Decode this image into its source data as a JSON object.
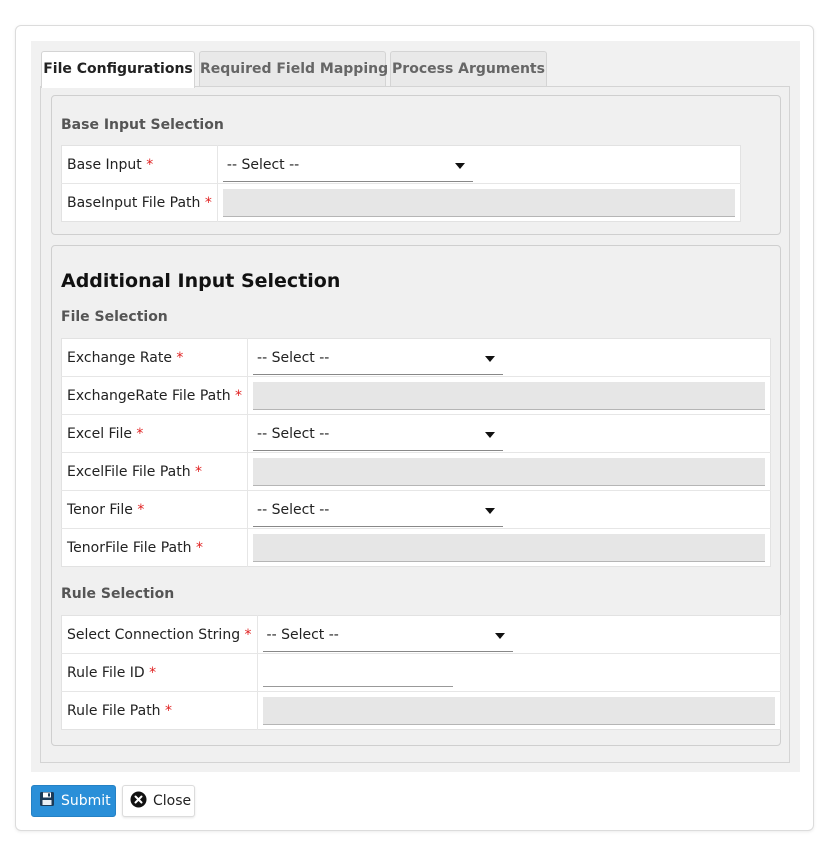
{
  "tabs": [
    "File Configurations",
    "Required Field Mapping",
    "Process Arguments"
  ],
  "required_marker": "*",
  "select_placeholder": "-- Select --",
  "base_section": {
    "legend": "Base Input Selection",
    "rows": [
      {
        "label": "Base Input",
        "type": "select",
        "value": "-- Select --"
      },
      {
        "label": "BaseInput File Path",
        "type": "path",
        "value": ""
      }
    ]
  },
  "additional_section": {
    "title": "Additional Input Selection",
    "file_selection": {
      "legend": "File Selection",
      "rows": [
        {
          "label": "Exchange Rate",
          "type": "select",
          "value": "-- Select --"
        },
        {
          "label": "ExchangeRate File Path",
          "type": "path",
          "value": ""
        },
        {
          "label": "Excel File",
          "type": "select",
          "value": "-- Select --"
        },
        {
          "label": "ExcelFile File Path",
          "type": "path",
          "value": ""
        },
        {
          "label": "Tenor File",
          "type": "select",
          "value": "-- Select --"
        },
        {
          "label": "TenorFile File Path",
          "type": "path",
          "value": ""
        }
      ]
    },
    "rule_selection": {
      "legend": "Rule Selection",
      "rows": [
        {
          "label": "Select Connection String",
          "type": "select",
          "value": "-- Select --"
        },
        {
          "label": "Rule File ID",
          "type": "text",
          "value": ""
        },
        {
          "label": "Rule File Path",
          "type": "path",
          "value": ""
        }
      ]
    }
  },
  "buttons": {
    "submit": "Submit",
    "close": "Close"
  },
  "icons": {
    "submit": "floppy-disk-icon",
    "close": "close-circle-icon"
  },
  "colors": {
    "primary": "#2a8fd8",
    "required": "#e02020"
  }
}
